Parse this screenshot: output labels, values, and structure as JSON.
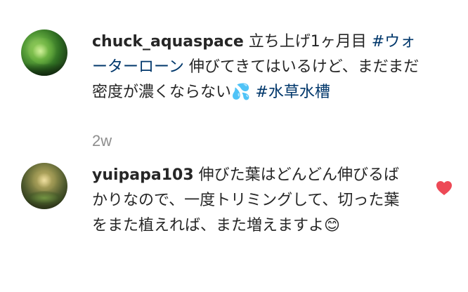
{
  "post": {
    "username": "chuck_aquaspace",
    "caption_1": " 立ち上げ1ヶ月目 ",
    "hashtag_1": "#ウォーターローン",
    "caption_2": " 伸びてきてはいるけど、まだまだ密度が濃くならない",
    "emoji_1": "💦",
    "hashtag_2": "#水草水槽",
    "timestamp": "2w"
  },
  "comment": {
    "username": "yuipapa103",
    "text": " 伸びた葉はどんどん伸びるばかりなので、一度トリミングして、切った葉をまた植えれば、また増えますよ",
    "emoji": "😊"
  },
  "colors": {
    "text": "#262626",
    "hashtag": "#00376b",
    "muted": "#8e8e8e",
    "like": "#ed4956"
  },
  "icons": {
    "like": "heart-icon"
  }
}
